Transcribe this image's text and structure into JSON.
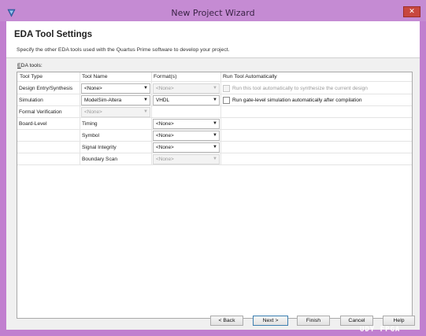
{
  "window": {
    "title": "New Project Wizard",
    "close_symbol": "✕",
    "accent": "#c58bd3",
    "close_color": "#c8473f"
  },
  "header": {
    "title": "EDA Tool Settings",
    "description": "Specify the other EDA tools used with the Quartus Prime software to develop your project."
  },
  "eda_tools_label_prefix": "E",
  "eda_tools_label_rest": "DA tools:",
  "columns": {
    "tool_type": "Tool Type",
    "tool_name": "Tool Name",
    "formats": "Format(s)",
    "run": "Run Tool Automatically"
  },
  "rows": [
    {
      "tool_type": "Design Entry/Synthesis",
      "tool_name": "<None>",
      "tool_name_enabled": true,
      "format": "<None>",
      "format_enabled": false,
      "run_label": "Run this tool automatically to synthesize the current design",
      "run_enabled": false,
      "run_checked": false
    },
    {
      "tool_type": "Simulation",
      "tool_name": "ModelSim-Altera",
      "tool_name_enabled": true,
      "format": "VHDL",
      "format_enabled": true,
      "run_label": "Run gate-level simulation automatically after compilation",
      "run_enabled": true,
      "run_checked": false
    },
    {
      "tool_type": "Formal Verification",
      "tool_name": "<None>",
      "tool_name_enabled": false
    },
    {
      "tool_type": "Board-Level",
      "tool_name": "Timing",
      "format": "<None>",
      "format_enabled": true
    },
    {
      "tool_name": "Symbol",
      "format": "<None>",
      "format_enabled": true
    },
    {
      "tool_name": "Signal Integrity",
      "format": "<None>",
      "format_enabled": true
    },
    {
      "tool_name": "Boundary Scan",
      "format": "<None>",
      "format_enabled": false
    }
  ],
  "buttons": {
    "back": "< Back",
    "next": "Next >",
    "finish": "Finish",
    "cancel": "Cancel",
    "help": "Help"
  },
  "watermark": "UDY FPGA",
  "icons": {
    "app": "quartus-app-icon",
    "dropdown": "▼"
  }
}
